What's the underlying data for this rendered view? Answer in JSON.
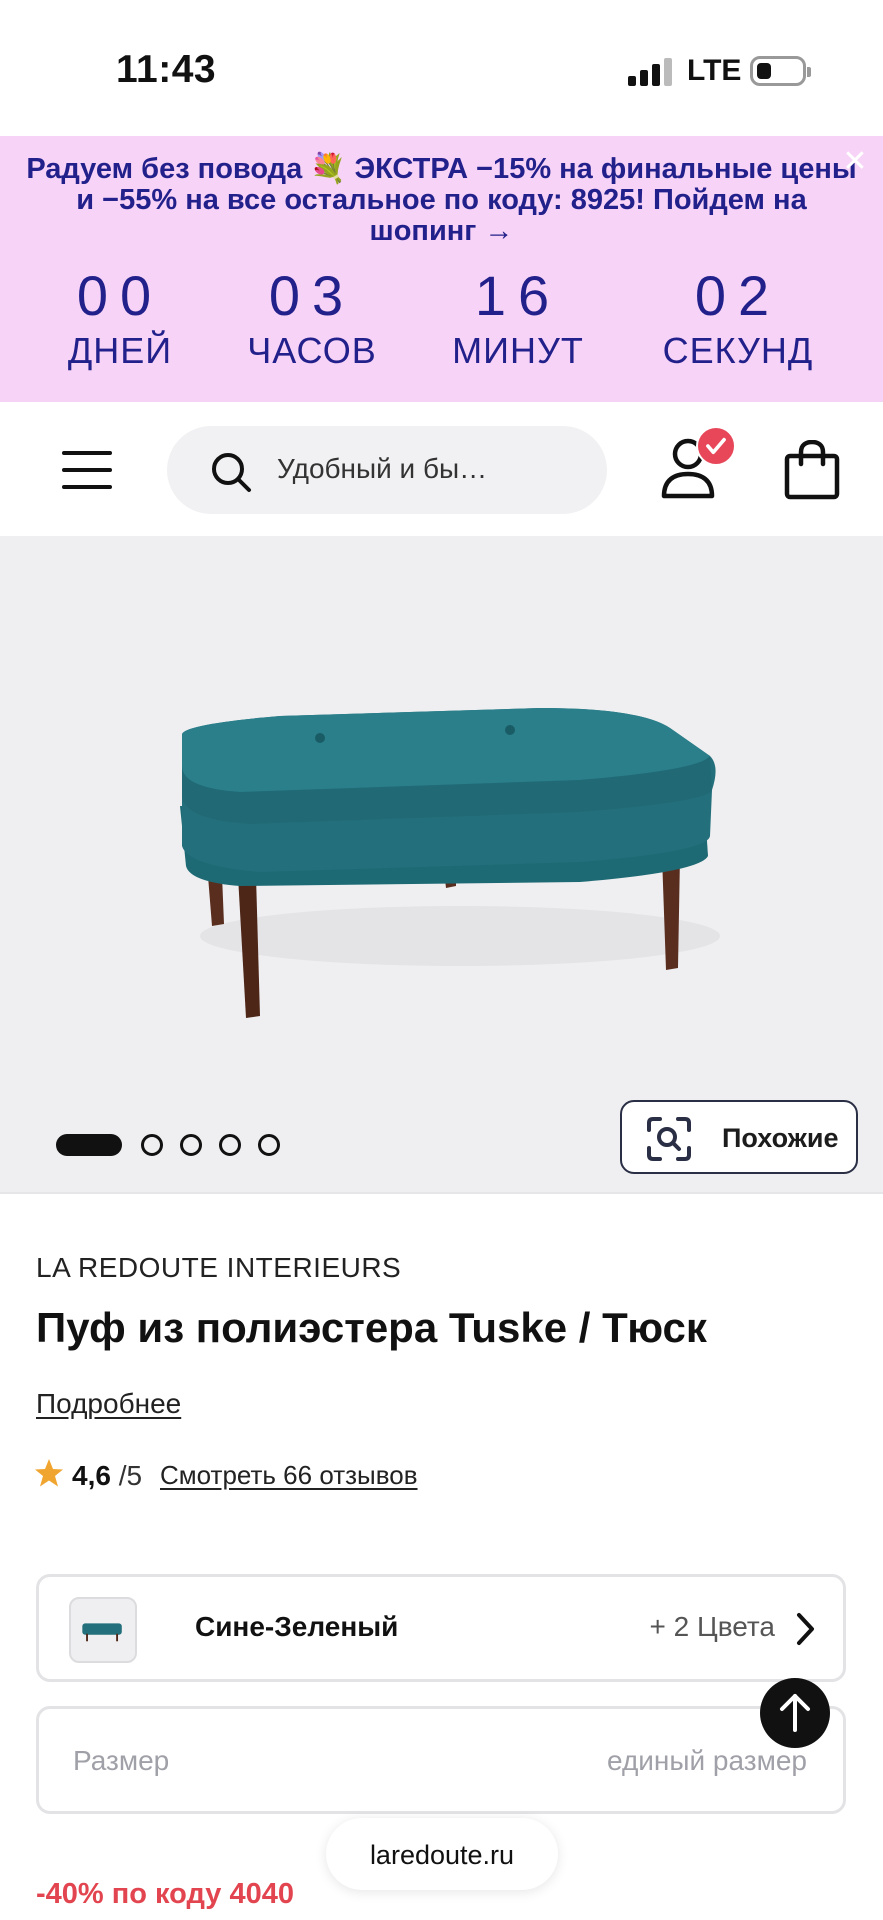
{
  "status_bar": {
    "time": "11:43",
    "network": "LTE"
  },
  "promo_banner": {
    "text": "Радуем без повода 💐 ЭКСТРА −15% на финальные цены и −55% на все остальное по коду: 8925! Пойдем на шопинг →",
    "background": "#f7d3f7",
    "text_color": "#22208a",
    "countdown": [
      {
        "value": "00",
        "label": "ДНЕЙ"
      },
      {
        "value": "03",
        "label": "ЧАСОВ"
      },
      {
        "value": "16",
        "label": "МИНУТ"
      },
      {
        "value": "02",
        "label": "СЕКУНД"
      }
    ]
  },
  "header": {
    "search_placeholder": "Удобный и бы…",
    "icons": [
      "menu-icon",
      "search-icon",
      "user-icon",
      "shopping-bag-icon"
    ]
  },
  "gallery": {
    "image_count": 5,
    "active_index": 0,
    "similar_label": "Похожие"
  },
  "product": {
    "brand": "LA REDOUTE INTERIEURS",
    "title": "Пуф из полиэстера Tuske / Тюск",
    "more_link": "Подробнее",
    "rating_value": "4,6",
    "rating_max": "/5",
    "reviews_link": "Смотреть 66 отзывов",
    "star_color": "#f0a531"
  },
  "color_selector": {
    "name": "Сине-Зеленый",
    "more_colors": "+ 2 Цвета"
  },
  "size_selector": {
    "label": "Размер",
    "value": "единый размер"
  },
  "browser": {
    "url": "laredoute.ru"
  },
  "discount": {
    "text": "-40% по коду 4040",
    "color": "#e2454f"
  }
}
